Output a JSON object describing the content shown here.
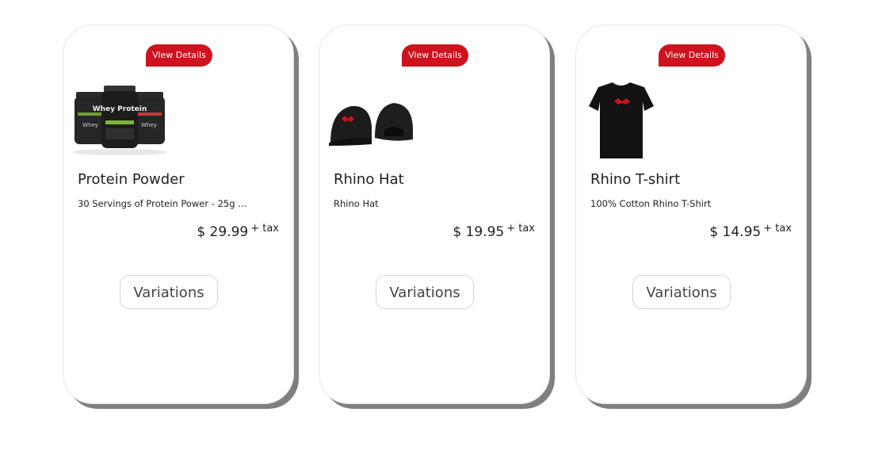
{
  "products": [
    {
      "details_label": "View Details",
      "name": "Protein Powder",
      "description": "30 Servings of Protein Power - 25g ...",
      "price": "$ 29.99",
      "tax_label": "+ tax",
      "variations_label": "Variations",
      "image": "protein-tubs-image",
      "label_text": "Whey Protein"
    },
    {
      "details_label": "View Details",
      "name": "Rhino Hat",
      "description": "Rhino Hat",
      "price": "$ 19.95",
      "tax_label": "+ tax",
      "variations_label": "Variations",
      "image": "black-caps-image"
    },
    {
      "details_label": "View Details",
      "name": "Rhino T-shirt",
      "description": "100% Cotton Rhino T-Shirt",
      "price": "$ 14.95",
      "tax_label": "+ tax",
      "variations_label": "Variations",
      "image": "black-tshirt-image"
    }
  ],
  "colors": {
    "accent": "#d0121e",
    "shadow": "#7f7f7f",
    "product_black": "#1c1c1c"
  }
}
